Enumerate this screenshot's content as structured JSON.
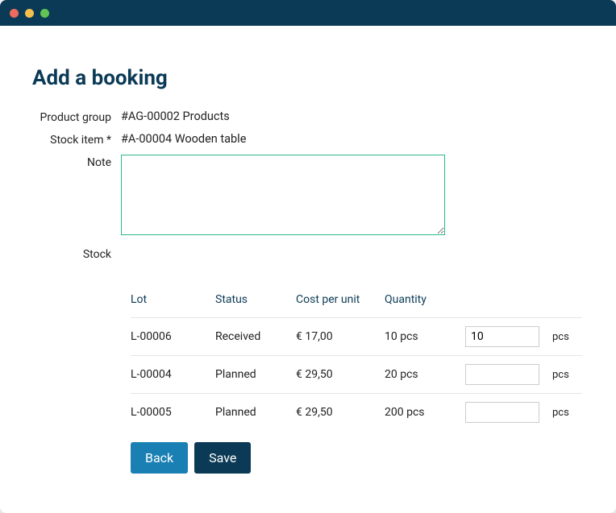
{
  "page": {
    "title": "Add a booking"
  },
  "form": {
    "product_group_label": "Product group",
    "product_group_value": "#AG-00002 Products",
    "stock_item_label": "Stock item *",
    "stock_item_value": "#A-00004 Wooden table",
    "note_label": "Note",
    "note_value": "",
    "stock_label": "Stock"
  },
  "table": {
    "headers": {
      "lot": "Lot",
      "status": "Status",
      "cost": "Cost per unit",
      "quantity": "Quantity"
    },
    "unit_suffix": "pcs",
    "rows": [
      {
        "lot": "L-00006",
        "status": "Received",
        "cost": "€ 17,00",
        "quantity": "10 pcs",
        "input": "10"
      },
      {
        "lot": "L-00004",
        "status": "Planned",
        "cost": "€ 29,50",
        "quantity": "20 pcs",
        "input": ""
      },
      {
        "lot": "L-00005",
        "status": "Planned",
        "cost": "€ 29,50",
        "quantity": "200 pcs",
        "input": ""
      }
    ]
  },
  "buttons": {
    "back": "Back",
    "save": "Save"
  }
}
